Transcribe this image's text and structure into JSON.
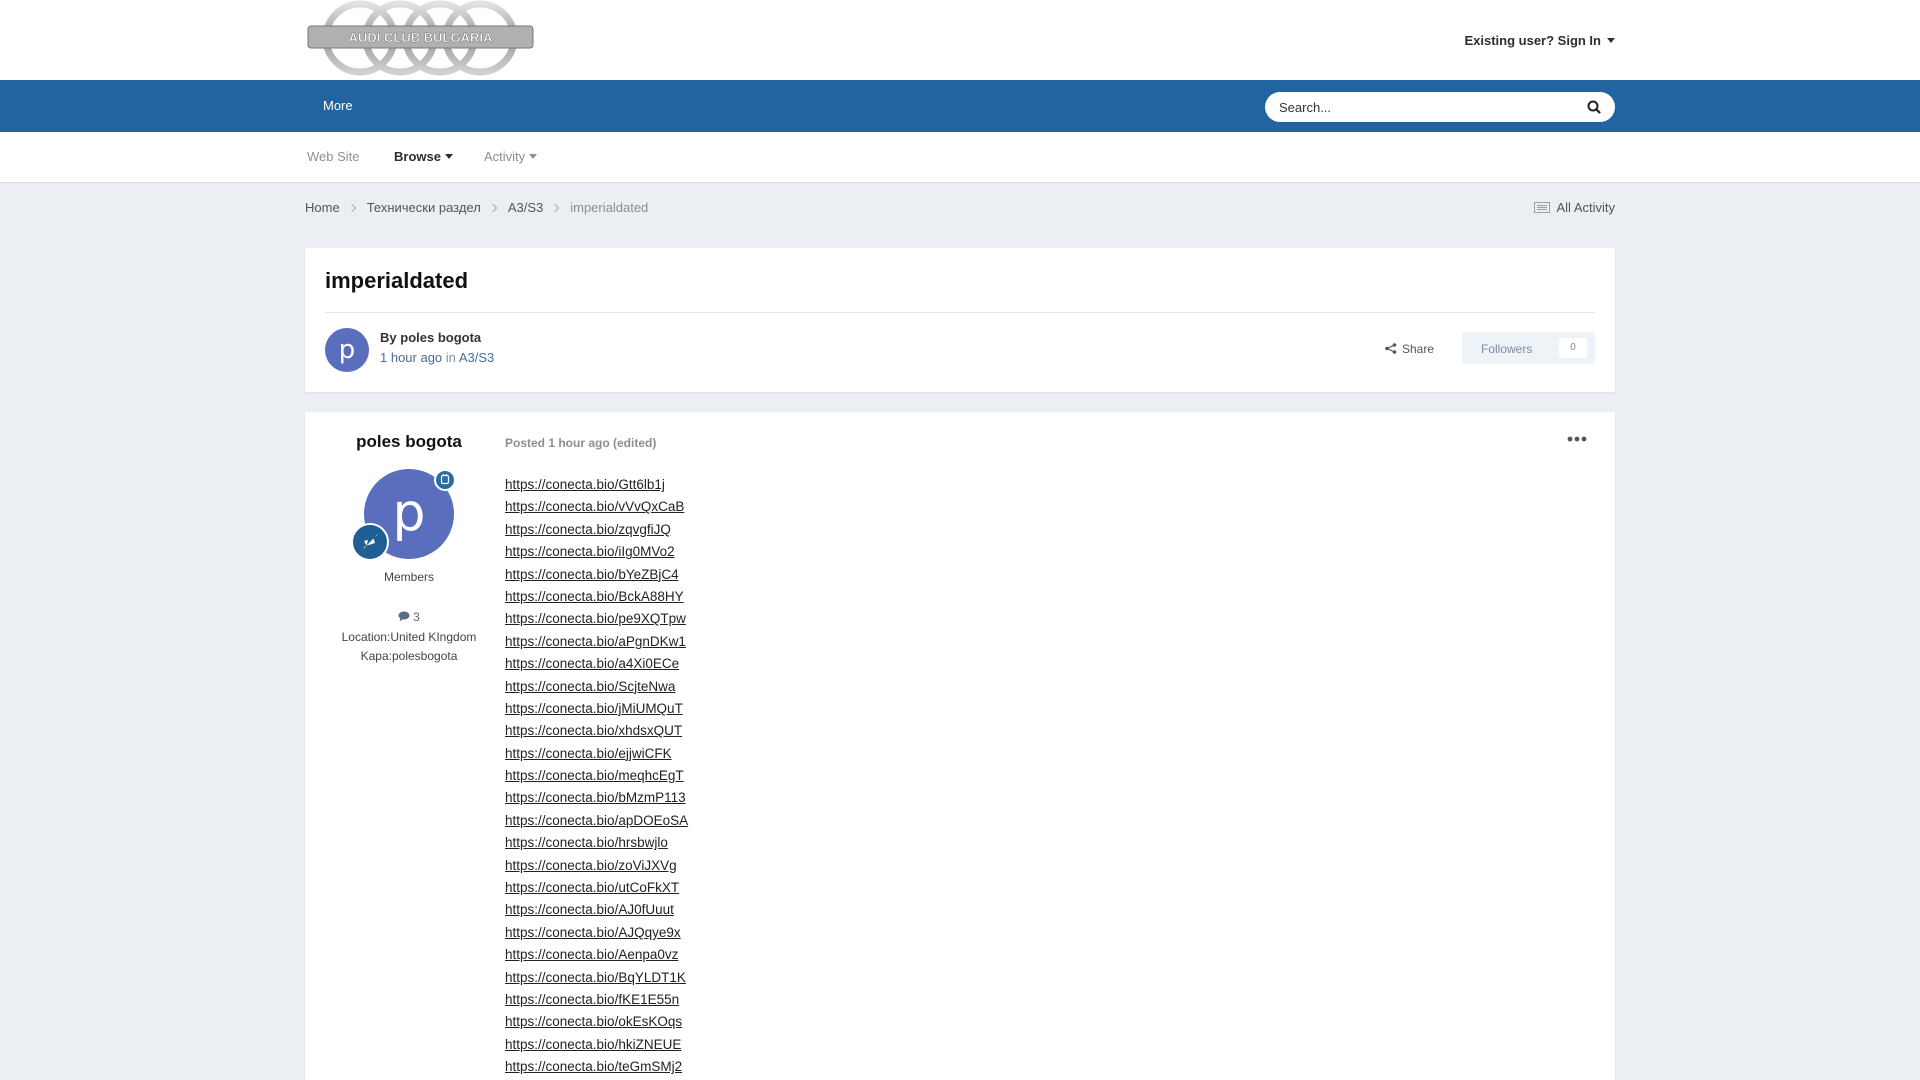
{
  "header": {
    "logo_text": "AUDI CLUB BULGARIA",
    "signin_label": "Existing user? Sign In"
  },
  "navbar": {
    "more_label": "More",
    "search_placeholder": "Search..."
  },
  "subnav": {
    "items": [
      {
        "label": "Web Site"
      },
      {
        "label": "Browse"
      },
      {
        "label": "Activity"
      }
    ]
  },
  "breadcrumb": {
    "items": [
      "Home",
      "Технически раздел",
      "A3/S3"
    ],
    "current": "imperialdated",
    "all_activity": "All Activity"
  },
  "topic": {
    "title": "imperialdated",
    "author_initial": "p",
    "by_prefix": "By",
    "author": "poles bogota",
    "time": "1 hour ago",
    "in_word": "in",
    "forum": "A3/S3",
    "share_label": "Share",
    "followers_label": "Followers",
    "followers_count": "0"
  },
  "post": {
    "author": "poles bogota",
    "author_initial": "p",
    "group": "Members",
    "post_count": "3",
    "location": "Location:United KIngdom",
    "kapa": "Kapa:polesbogota",
    "posted_label": "Posted 1 hour ago (edited)",
    "links": [
      "https://conecta.bio/Gtt6lb1j",
      "https://conecta.bio/vVvQxCaB",
      "https://conecta.bio/zqvgfiJQ",
      "https://conecta.bio/iIg0MVo2",
      "https://conecta.bio/bYeZBjC4",
      "https://conecta.bio/BckA88HY",
      "https://conecta.bio/pe9XQTpw",
      "https://conecta.bio/aPgnDKw1",
      "https://conecta.bio/a4Xi0ECe",
      "https://conecta.bio/ScjteNwa",
      "https://conecta.bio/jMiUMQuT",
      "https://conecta.bio/xhdsxQUT",
      "https://conecta.bio/ejjwiCFK",
      "https://conecta.bio/meqhcEgT",
      "https://conecta.bio/bMzmP113",
      "https://conecta.bio/apDOEoSA",
      "https://conecta.bio/hrsbwjlo",
      "https://conecta.bio/zoViJXVg",
      "https://conecta.bio/utCoFkXT",
      "https://conecta.bio/AJ0fUuut",
      "https://conecta.bio/AJQqye9x",
      "https://conecta.bio/Aenpa0vz",
      "https://conecta.bio/BqYLDT1K",
      "https://conecta.bio/fKE1E55n",
      "https://conecta.bio/okEsKOqs",
      "https://conecta.bio/hkiZNEUE",
      "https://conecta.bio/teGmSMj2"
    ]
  },
  "colors": {
    "navbar": "#2164a0",
    "avatar": "#5b6dbd",
    "page_bg": "#ebeef2"
  },
  "icons": [
    "caret-down-icon",
    "search-icon",
    "chevron-right-icon",
    "list-icon",
    "share-icon",
    "online-icon",
    "rocket-icon",
    "comment-icon",
    "ellipsis-icon"
  ]
}
